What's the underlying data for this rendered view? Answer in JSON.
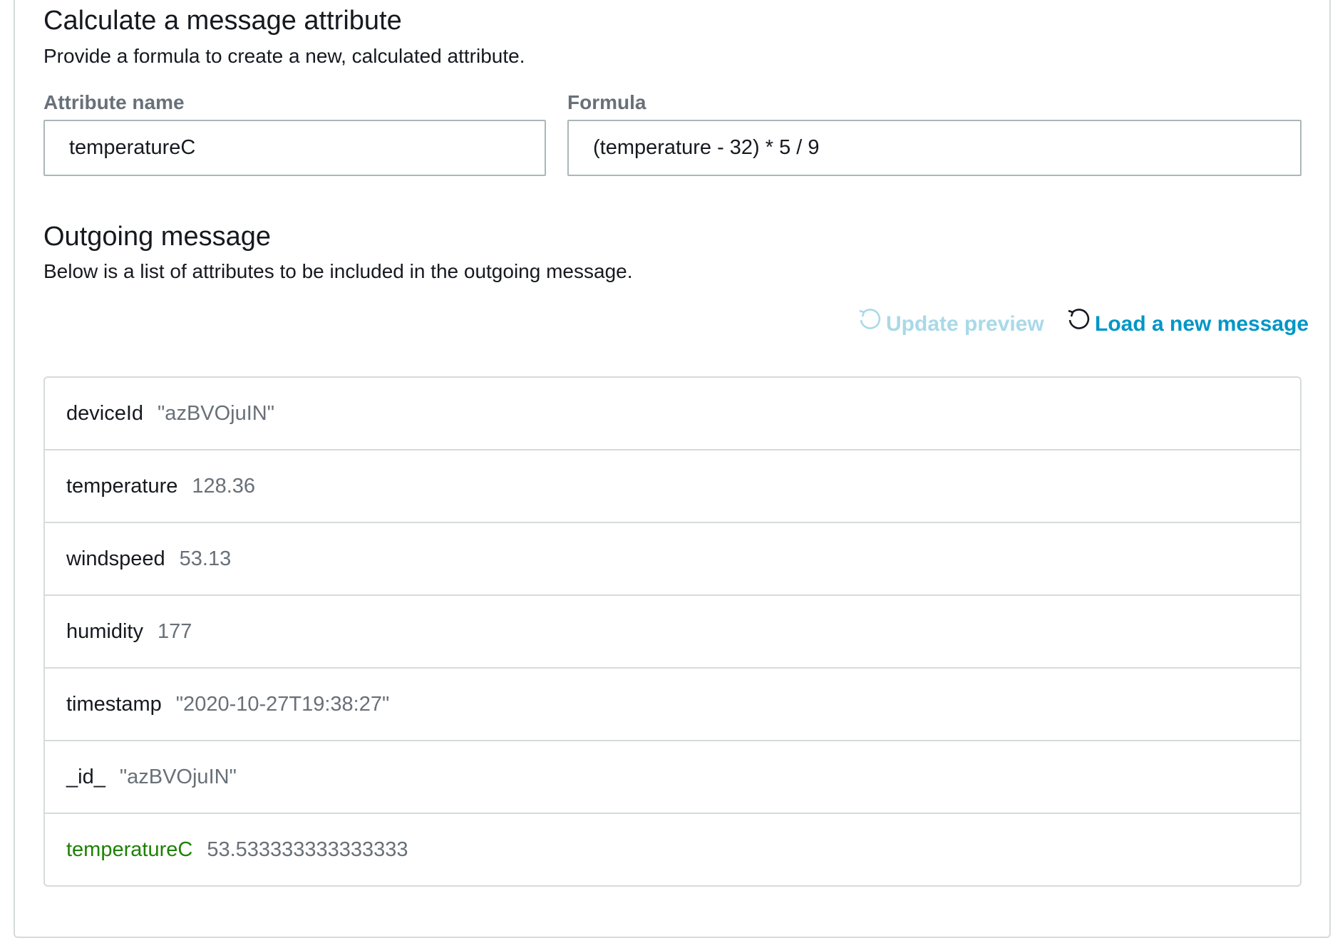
{
  "calculate": {
    "title": "Calculate a message attribute",
    "description": "Provide a formula to create a new, calculated attribute.",
    "attribute_name_label": "Attribute name",
    "attribute_name_value": "temperatureC",
    "formula_label": "Formula",
    "formula_value": "(temperature - 32) * 5 / 9"
  },
  "outgoing": {
    "title": "Outgoing message",
    "description": "Below is a list of attributes to be included in the outgoing message.",
    "update_preview_label": "Update preview",
    "load_message_label": "Load a new message",
    "attributes": [
      {
        "key": "deviceId",
        "value": "\"azBVOjuIN\"",
        "is_new": false
      },
      {
        "key": "temperature",
        "value": "128.36",
        "is_new": false
      },
      {
        "key": "windspeed",
        "value": "53.13",
        "is_new": false
      },
      {
        "key": "humidity",
        "value": "177",
        "is_new": false
      },
      {
        "key": "timestamp",
        "value": "\"2020-10-27T19:38:27\"",
        "is_new": false
      },
      {
        "key": "_id_",
        "value": "\"azBVOjuIN\"",
        "is_new": false
      },
      {
        "key": "temperatureC",
        "value": "53.533333333333333",
        "is_new": true
      }
    ]
  },
  "icons": {
    "update_preview": "refresh-icon",
    "load_message": "refresh-icon"
  },
  "colors": {
    "link_enabled": "#0096c6",
    "link_disabled": "#a9d9e8",
    "new_attribute": "#1d8102"
  }
}
